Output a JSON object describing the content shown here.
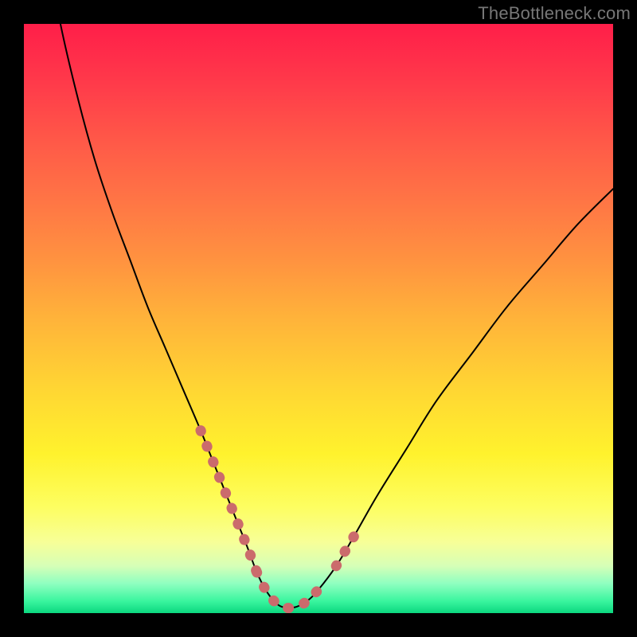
{
  "watermark": "TheBottleneck.com",
  "colors": {
    "page_bg": "#000000",
    "curve": "#000000",
    "highlight": "#cb6b6c",
    "gradient_stops": [
      "#ff1e49",
      "#ff3a4a",
      "#ff5948",
      "#ff7545",
      "#ff9240",
      "#ffb33a",
      "#ffd633",
      "#fff22d",
      "#fdfe61",
      "#f7ff98",
      "#d6ffb7",
      "#8effc0",
      "#39f59e",
      "#0bd77f"
    ]
  },
  "chart_data": {
    "type": "line",
    "title": "",
    "xlabel": "",
    "ylabel": "",
    "xlim": [
      0,
      100
    ],
    "ylim": [
      0,
      100
    ],
    "x": [
      0,
      3,
      6,
      9,
      12,
      15,
      18,
      21,
      24,
      27,
      30,
      32,
      34,
      36,
      38,
      39.5,
      41,
      42.5,
      44,
      46,
      48,
      50,
      53,
      56,
      60,
      65,
      70,
      76,
      82,
      88,
      94,
      100
    ],
    "values": [
      140,
      118,
      101,
      88,
      77,
      68,
      60,
      52,
      45,
      38,
      31,
      26,
      21,
      16,
      11,
      7,
      4,
      2,
      1,
      1,
      2,
      4,
      8,
      13,
      20,
      28,
      36,
      44,
      52,
      59,
      66,
      72
    ],
    "highlight_segments": [
      {
        "x": [
          30,
          32,
          34,
          36,
          38,
          39.5
        ],
        "values": [
          31,
          26,
          21,
          16,
          11,
          7
        ]
      },
      {
        "x": [
          39.5,
          41,
          42.5,
          44,
          46,
          48,
          50
        ],
        "values": [
          7,
          4,
          2,
          1,
          1,
          2,
          4
        ]
      },
      {
        "x": [
          53,
          56
        ],
        "values": [
          8,
          13
        ]
      }
    ]
  }
}
